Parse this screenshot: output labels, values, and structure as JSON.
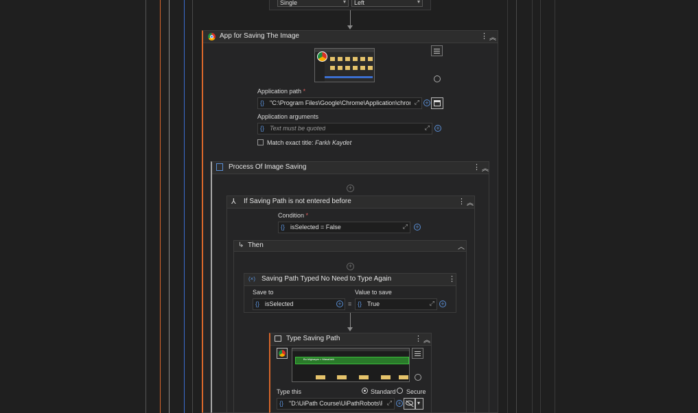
{
  "top_dropdowns": {
    "mode": "Single",
    "position": "Left"
  },
  "open_app": {
    "title": "App for Saving The Image",
    "app_path_label": "Application path",
    "app_path_value": "\"C:\\Program Files\\Google\\Chrome\\Application\\chrom",
    "app_args_label": "Application arguments",
    "app_args_placeholder": "Text must be quoted",
    "match_title_label": "Match exact title:",
    "match_title_value": "Farklı Kaydet"
  },
  "process": {
    "title": "Process Of Image Saving"
  },
  "if_activity": {
    "title": "If Saving Path is not entered before",
    "condition_label": "Condition",
    "condition_value": "isSelected = False"
  },
  "then_block": {
    "title": "Then"
  },
  "assign": {
    "title": "Saving Path Typed No Need to Type Again",
    "save_to_label": "Save to",
    "save_to_value": "isSelected",
    "value_label": "Value to save",
    "value_value": "True",
    "equals": "="
  },
  "type_into": {
    "title": "Type Saving Path",
    "type_this_label": "Type this",
    "standard_label": "Standard",
    "secure_label": "Secure",
    "type_value": "\"D:\\UiPath Course\\UiPathRobots\\Rc",
    "thumb_text": "Bu bilgisayar > Masaüstü"
  },
  "symbols": {
    "required": "*",
    "kebab": "⋮",
    "collapse": "≪",
    "expand": "⤢",
    "plus": "+",
    "brace": "{}",
    "fx": "(×)",
    "chevron_up": "⌃"
  },
  "colors": {
    "orange_rail": "#d9672b",
    "blue_rail": "#3b6fd1",
    "accent": "#5a8fd6"
  }
}
